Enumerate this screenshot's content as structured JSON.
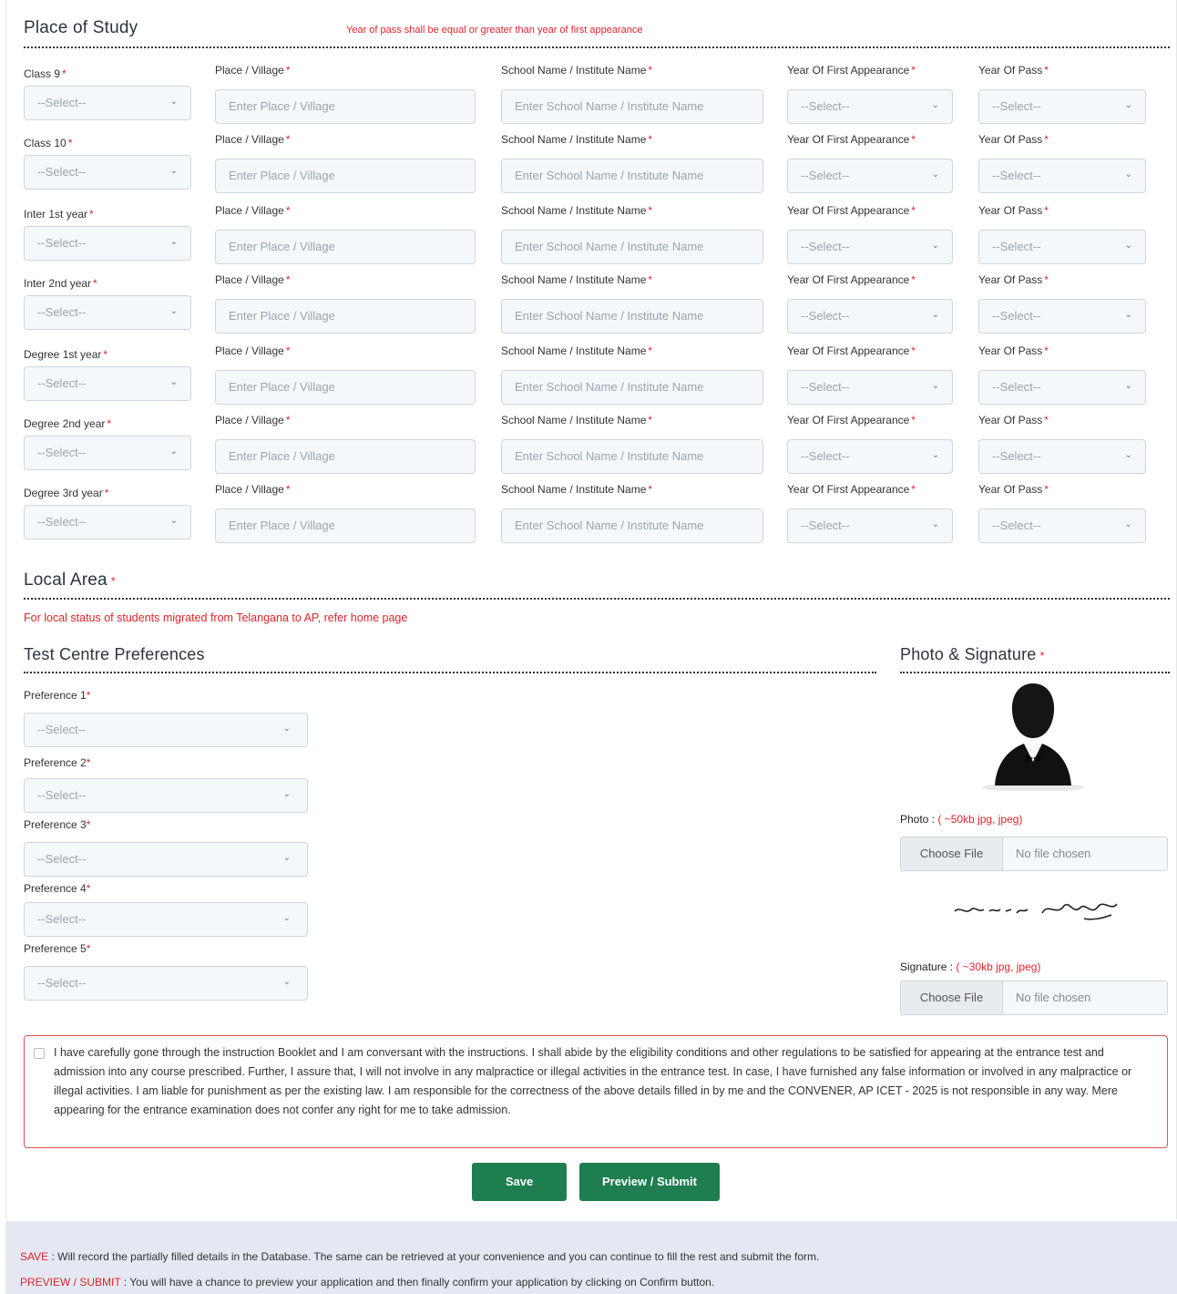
{
  "place_of_study": {
    "title": "Place of Study",
    "note": "Year of pass shall be equal or greater than year of first appearance",
    "field_labels": {
      "place": "Place / Village",
      "school": "School Name / Institute Name",
      "first_appearance": "Year Of First Appearance",
      "year_of_pass": "Year Of Pass"
    },
    "placeholders": {
      "select": "--Select--",
      "place": "Enter Place / Village",
      "school": "Enter School Name / Institute Name"
    },
    "rows": [
      {
        "label": "Class 9"
      },
      {
        "label": "Class 10"
      },
      {
        "label": "Inter 1st year"
      },
      {
        "label": "Inter 2nd year"
      },
      {
        "label": "Degree 1st year"
      },
      {
        "label": "Degree 2nd year"
      },
      {
        "label": "Degree 3rd year"
      }
    ]
  },
  "local_area": {
    "title": "Local Area",
    "note": "For local status of students migrated from Telangana to AP, refer home page"
  },
  "test_centre": {
    "title": "Test Centre Preferences",
    "preferences": [
      {
        "label": "Preference 1",
        "value": "--Select--"
      },
      {
        "label": "Preference 2",
        "value": "--Select--"
      },
      {
        "label": "Preference 3",
        "value": "--Select--"
      },
      {
        "label": "Preference 4",
        "value": "--Select--"
      },
      {
        "label": "Preference 5",
        "value": "--Select--"
      }
    ]
  },
  "photo_signature": {
    "title": "Photo & Signature",
    "photo_label": "Photo :",
    "photo_hint": "( ~50kb jpg, jpeg)",
    "signature_label": "Signature :",
    "signature_hint": "( ~30kb jpg, jpeg)",
    "choose_file": "Choose File",
    "no_file": "No file chosen"
  },
  "declaration": {
    "text": "I have carefully gone through the instruction Booklet and I am conversant with the instructions. I shall abide by the eligibility conditions and other regulations to be satisfied for appearing at the entrance test and admission into any course prescribed. Further, I assure that, I will not involve in any malpractice or illegal activities in the entrance test. In case, I have furnished any false information or involved in any malpractice or illegal activities. I am liable for punishment as per the existing law. I am responsible for the correctness of the above details filled in by me and the CONVENER, AP ICET - 2025 is not responsible in any way. Mere appearing for the entrance examination does not confer any right for me to take admission."
  },
  "buttons": {
    "save": "Save",
    "preview": "Preview / Submit"
  },
  "footer": {
    "save_key": "SAVE",
    "save_text": " : Will record the partially filled details in the Database. The same can be retrieved at your convenience and you can continue to fill the rest and submit the form.",
    "preview_key": "PREVIEW / SUBMIT",
    "preview_text": " : You will have a chance to preview your application and then finally confirm your application by clicking on Confirm button."
  },
  "colors": {
    "accent_green": "#1e7e4f",
    "required_red": "#e0242b",
    "footer_bg": "#e5e8f2"
  }
}
